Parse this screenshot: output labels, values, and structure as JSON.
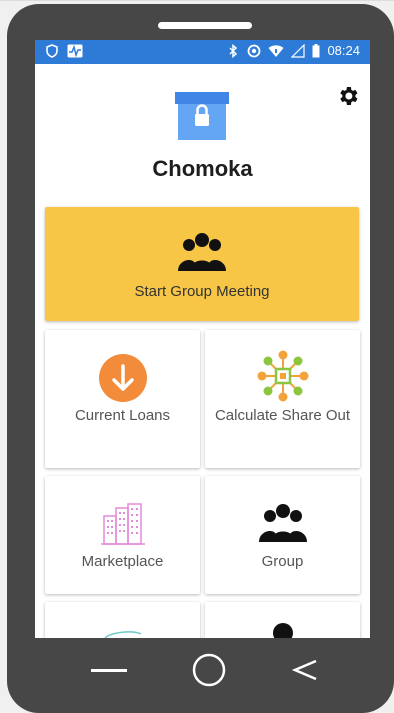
{
  "status_bar": {
    "time": "08:24",
    "color": "#2d7bd6",
    "left_icons": [
      "shield-icon",
      "activity-icon"
    ],
    "right_icons": [
      "bluetooth-icon",
      "do-not-disturb-icon",
      "wifi-icon",
      "signal-icon",
      "battery-icon"
    ]
  },
  "header": {
    "title": "Chomoka",
    "logo_icon": "lock-box-icon",
    "settings_icon": "gear-icon"
  },
  "main_tile": {
    "label": "Start Group Meeting",
    "icon": "group-icon",
    "color": "#f7c646"
  },
  "tiles": [
    {
      "label": "Current Loans",
      "icon": "arrow-down-circle-icon",
      "icon_color": "#f28c3b"
    },
    {
      "label": "Calculate Share Out",
      "icon": "share-network-icon"
    },
    {
      "label": "Marketplace",
      "icon": "buildings-icon",
      "icon_color": "#e48ad8"
    },
    {
      "label": "Group",
      "icon": "group-icon"
    }
  ],
  "nav": {
    "icons": [
      "menu-line-icon",
      "home-circle-icon",
      "back-chevron-icon"
    ]
  }
}
